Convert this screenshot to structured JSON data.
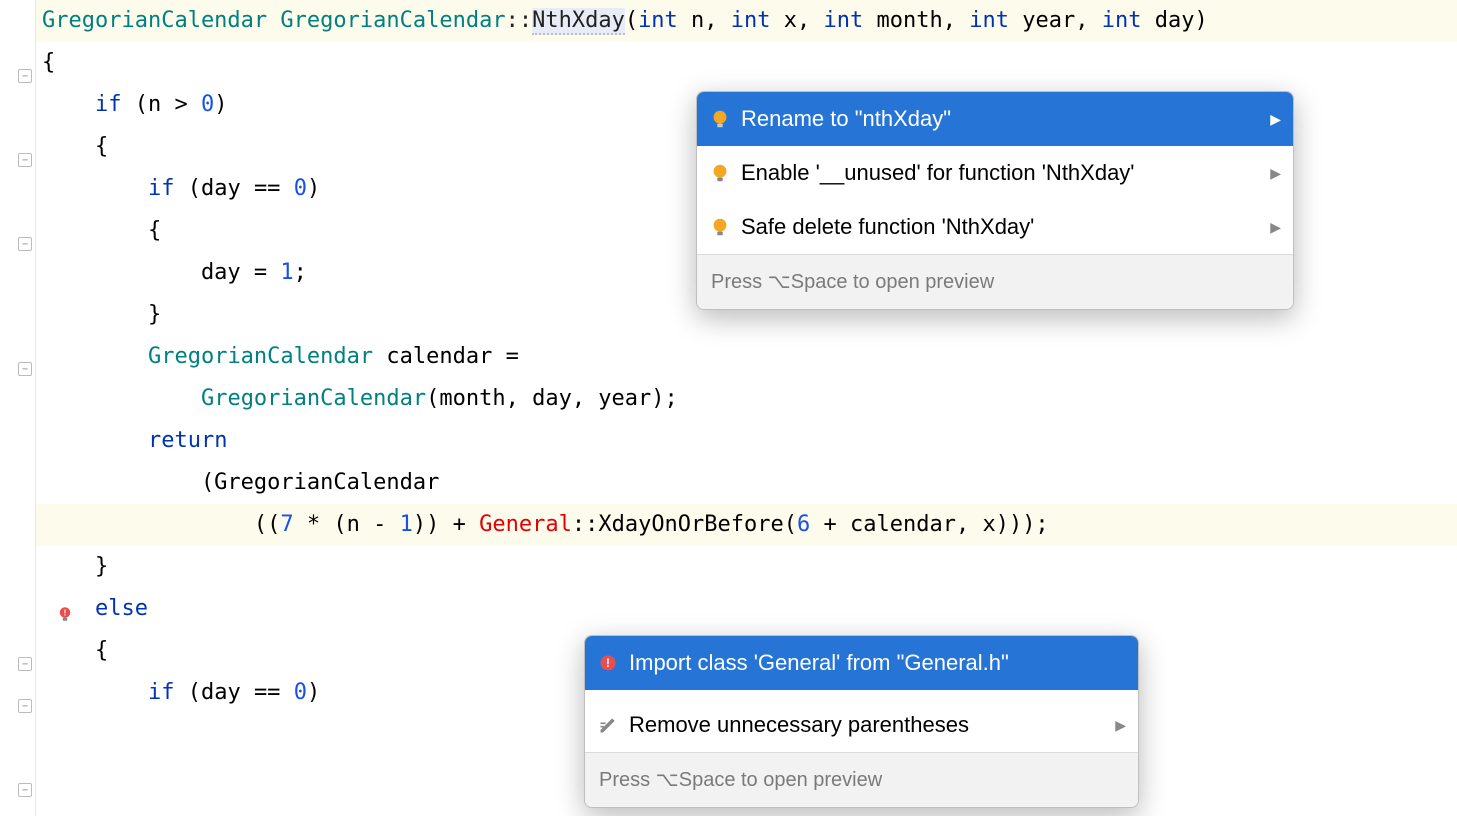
{
  "code": {
    "l1": "",
    "l2_type1": "GregorianCalendar",
    "l2_type2": "GregorianCalendar",
    "l2_op": "::",
    "l2_method": "NthXday",
    "l2_params_kw1": "int",
    "l2_params_p1": " n, ",
    "l2_params_kw2": "int",
    "l2_params_p2": " x, ",
    "l2_params_kw3": "int",
    "l2_params_p3": " month, ",
    "l2_params_kw4": "int",
    "l2_params_p4": " year, ",
    "l2_params_kw5": "int",
    "l2_params_p5": " day)",
    "l3": "{",
    "l4_kw": "if",
    "l4_txt": " (n > ",
    "l4_num": "0",
    "l4_end": ")",
    "l5": "    {",
    "l6_kw": "if",
    "l6_txt": " (day == ",
    "l6_num": "0",
    "l6_end": ")",
    "l7": "        {",
    "l8_txt": "            day = ",
    "l8_num": "1",
    "l8_end": ";",
    "l9": "        }",
    "l10_type": "GregorianCalendar",
    "l10_txt": " calendar =",
    "l11_type": "GregorianCalendar",
    "l11_txt": "(month, day, year);",
    "l12": "",
    "l13_kw": "return",
    "l14_txt": "            (GregorianCalendar",
    "l15_a": "                ((",
    "l15_num1": "7",
    "l15_b": " * (n - ",
    "l15_num2": "1",
    "l15_c": ")) + ",
    "l15_err": "General",
    "l15_d": "::XdayOnOrBefore(",
    "l15_num3": "6",
    "l15_e": " + calendar, x)));",
    "l16": "    }",
    "l17_kw": "else",
    "l18": "    {",
    "l19_kw": "if",
    "l19_txt": " (day == ",
    "l19_num": "0",
    "l19_end": ")"
  },
  "popup1": {
    "item1": "Rename to \"nthXday\"",
    "item2": "Enable '__unused' for function 'NthXday'",
    "item3": "Safe delete function 'NthXday'",
    "footer": "Press ⌥Space to open preview"
  },
  "popup2": {
    "item1": "Import class 'General' from \"General.h\"",
    "item2": "Remove unnecessary parentheses",
    "footer": "Press ⌥Space to open preview"
  },
  "colors": {
    "accent": "#2675d6",
    "keyword": "#0033b3",
    "type": "#008080",
    "number": "#1750eb",
    "error": "#e30000"
  }
}
